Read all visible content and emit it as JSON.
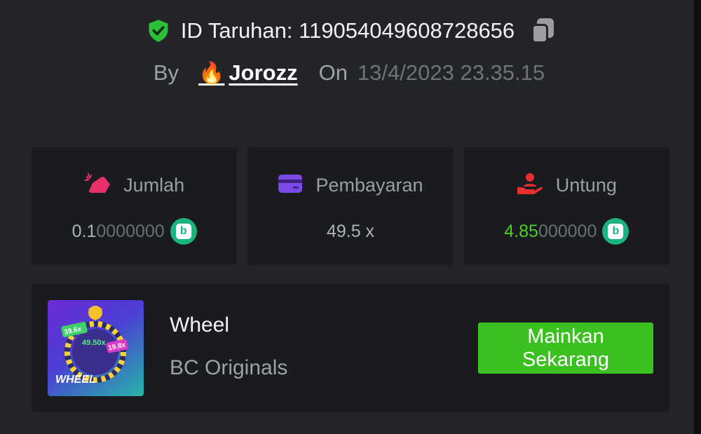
{
  "header": {
    "bet_id_label": "ID Taruhan: 119054049608728656",
    "by_label": "By",
    "username": "Jorozz",
    "on_label": "On",
    "datetime": "13/4/2023 23.35.15"
  },
  "stats": [
    {
      "title": "Jumlah",
      "value_main": "0.1",
      "value_dim": "0000000",
      "icon": "amount-icon",
      "color": "#e8316a"
    },
    {
      "title": "Pembayaran",
      "value": "49.5 x",
      "icon": "card-icon",
      "color": "#7c4ae8"
    },
    {
      "title": "Untung",
      "value_main": "4.85",
      "value_dim": "000000",
      "icon": "profit-icon",
      "color": "#e8312f"
    }
  ],
  "game": {
    "title": "Wheel",
    "provider": "BC Originals",
    "play_label": "Mainkan Sekarang",
    "thumb_text": "WHEEL",
    "thumb_multipliers": [
      "39.6x",
      "49.50x",
      "19.8x"
    ]
  },
  "colors": {
    "accent_green": "#3bc11f",
    "profit_green": "#4cce2a",
    "coin_green": "#1bb37e"
  }
}
